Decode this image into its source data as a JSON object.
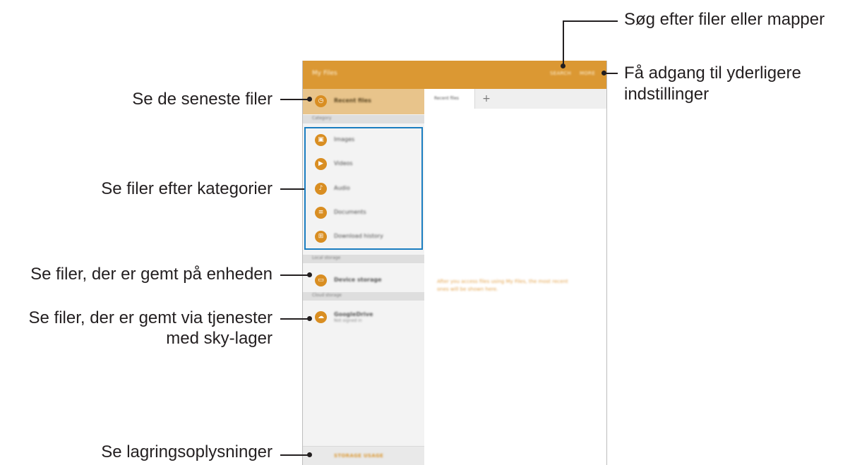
{
  "app": {
    "title": "My Files",
    "actions": {
      "search": "SEARCH",
      "more": "MORE"
    },
    "accent_color": "#db9833"
  },
  "sidebar": {
    "recent": {
      "label": "Recent files",
      "icon": "clock-icon"
    },
    "category_header": "Category",
    "categories": [
      {
        "label": "Images",
        "icon": "image-icon",
        "glyph": "▣"
      },
      {
        "label": "Videos",
        "icon": "video-icon",
        "glyph": "▶"
      },
      {
        "label": "Audio",
        "icon": "music-note-icon",
        "glyph": "♪"
      },
      {
        "label": "Documents",
        "icon": "document-icon",
        "glyph": "≡"
      },
      {
        "label": "Download history",
        "icon": "download-grid-icon",
        "glyph": "⊞"
      }
    ],
    "local_header": "Local storage",
    "device_storage": {
      "label": "Device storage",
      "icon": "device-icon",
      "glyph": "▭"
    },
    "cloud_header": "Cloud storage",
    "cloud_item": {
      "label": "GoogleDrive",
      "sublabel": "Not signed in",
      "icon": "cloud-icon",
      "glyph": "☁"
    },
    "storage_usage": "STORAGE USAGE"
  },
  "main": {
    "tab_label": "Recent files",
    "add_tab": "+",
    "empty_message": "After you access files using My Files, the most recent ones will be shown here."
  },
  "callouts": {
    "search": "Søg efter filer eller mapper",
    "more_line1": "Få adgang til yderligere",
    "more_line2": "indstillinger",
    "recent": "Se de seneste filer",
    "categories": "Se filer efter kategorier",
    "device": "Se filer, der er gemt på enheden",
    "cloud_line1": "Se filer, der er gemt via tjenester",
    "cloud_line2": "med sky-lager",
    "storage": "Se lagringsoplysninger"
  }
}
